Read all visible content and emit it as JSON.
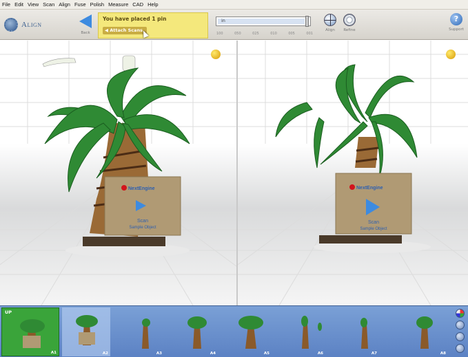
{
  "menu": [
    "File",
    "Edit",
    "View",
    "Scan",
    "Align",
    "Fuse",
    "Polish",
    "Measure",
    "CAD",
    "Help"
  ],
  "toolbar": {
    "mode_label": "Align",
    "back_label": "Back",
    "status_message": "You have placed 1 pin",
    "attach_button": "◀ Attach Scans",
    "slider_value": "in",
    "slider_ticks": [
      "100",
      "050",
      "025",
      "010",
      "005",
      "001"
    ],
    "tools": [
      "Align",
      "Refine"
    ],
    "help_label": "Support"
  },
  "viewports": {
    "box_brand": "NextEngine",
    "box_line1": "Scan",
    "box_line2": "Sample Object"
  },
  "thumbnails": {
    "up_label": "UP",
    "items": [
      "A1",
      "A2",
      "A3",
      "A4",
      "A5",
      "A6",
      "A7",
      "A8"
    ]
  },
  "colors": {
    "accent": "#3d8be0",
    "status_bg": "#f4e87c",
    "strip": "#6a8fcd",
    "selected_green": "#3aa43a"
  }
}
